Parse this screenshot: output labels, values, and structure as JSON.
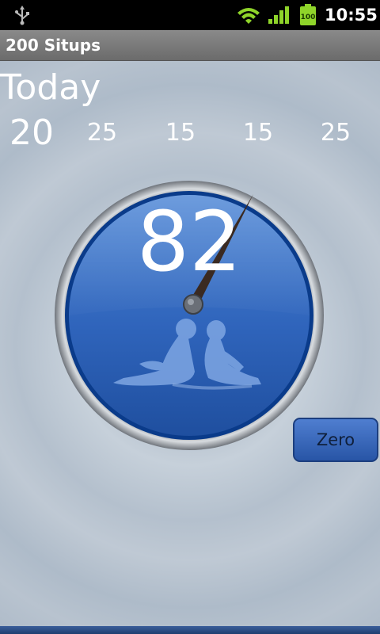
{
  "status_bar": {
    "time": "10:55",
    "battery_label": "100",
    "icons": [
      "usb-icon",
      "wifi-icon",
      "signal-icon",
      "battery-icon"
    ]
  },
  "title_bar": {
    "title": "200 Situps"
  },
  "main": {
    "today_label": "Today",
    "sets": [
      "20",
      "25",
      "15",
      "15",
      "25"
    ],
    "count": "82",
    "zero_label": "Zero"
  },
  "colors": {
    "accent": "#2f61b8",
    "background": "#b4c0cd"
  }
}
